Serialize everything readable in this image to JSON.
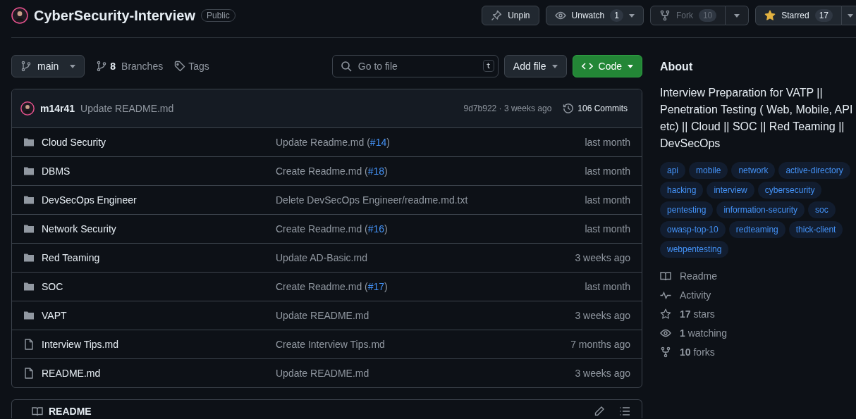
{
  "repo": {
    "name": "CyberSecurity-Interview",
    "visibility": "Public"
  },
  "actions": [
    {
      "kind": "pin",
      "label": "Unpin",
      "disabled": false
    },
    {
      "kind": "watch",
      "label": "Unwatch",
      "count": "1",
      "disabled": false
    },
    {
      "kind": "fork",
      "label": "Fork",
      "count": "10",
      "disabled": true
    },
    {
      "kind": "star",
      "label": "Starred",
      "count": "17",
      "disabled": false
    }
  ],
  "toolbar": {
    "branch": "main",
    "branches_count": "8",
    "branches_label": "Branches",
    "tags_label": "Tags",
    "search_placeholder": "Go to file",
    "shortcut": "t",
    "add_file": "Add file",
    "code": "Code"
  },
  "commit": {
    "author": "m14r41",
    "message": "Update README.md",
    "meta": "9d7b922 · 3 weeks ago",
    "commits": "106 Commits"
  },
  "files": [
    {
      "kind": "folder",
      "name": "Cloud Security",
      "message": "Update Readme.md (",
      "link": "#14",
      "message_end": ")",
      "time": "last month"
    },
    {
      "kind": "folder",
      "name": "DBMS",
      "message": "Create Readme.md (",
      "link": "#18",
      "message_end": ")",
      "time": "last month"
    },
    {
      "kind": "folder",
      "name": "DevSecOps Engineer",
      "message": "Delete DevSecOps Engineer/readme.md.txt",
      "time": "last month"
    },
    {
      "kind": "folder",
      "name": "Network Security",
      "message": "Create Readme.md (",
      "link": "#16",
      "message_end": ")",
      "time": "last month"
    },
    {
      "kind": "folder",
      "name": "Red Teaming",
      "message": "Update AD-Basic.md",
      "time": "3 weeks ago"
    },
    {
      "kind": "folder",
      "name": "SOC",
      "message": "Create Readme.md (",
      "link": "#17",
      "message_end": ")",
      "time": "last month"
    },
    {
      "kind": "folder",
      "name": "VAPT",
      "message": "Update README.md",
      "time": "3 weeks ago"
    },
    {
      "kind": "file",
      "name": "Interview Tips.md",
      "message": "Create Interview Tips.md",
      "time": "7 months ago"
    },
    {
      "kind": "file",
      "name": "README.md",
      "message": "Update README.md",
      "time": "3 weeks ago"
    }
  ],
  "readme": {
    "title": "README"
  },
  "about": {
    "title": "About",
    "description": "Interview Preparation for VATP || Penetration Testing ( Web, Mobile, API etc) || Cloud || SOC || Red Teaming || DevSecOps",
    "topics": [
      "api",
      "mobile",
      "network",
      "active-directory",
      "hacking",
      "interview",
      "cybersecurity",
      "pentesting",
      "information-security",
      "soc",
      "owasp-top-10",
      "redteaming",
      "thick-client",
      "webpentesting"
    ],
    "links": [
      {
        "kind": "readme",
        "label": "Readme"
      },
      {
        "kind": "activity",
        "label": "Activity"
      },
      {
        "kind": "stars",
        "count": "17",
        "label": "stars"
      },
      {
        "kind": "watching",
        "count": "1",
        "label": "watching"
      },
      {
        "kind": "forks",
        "count": "10",
        "label": "forks"
      }
    ]
  }
}
